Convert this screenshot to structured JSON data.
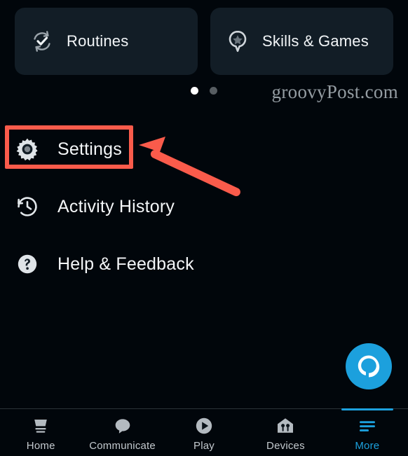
{
  "app": {
    "background_color": "#01060b",
    "card_color": "#121d26",
    "accent_color": "#1ca0dd",
    "annotation_color": "#fa5b4b"
  },
  "carousel": {
    "cards": [
      {
        "label": "Routines",
        "icon": "routines-refresh-check-icon"
      },
      {
        "label": "Skills & Games",
        "icon": "skills-pin-star-icon"
      }
    ],
    "dots": [
      {
        "active": true
      },
      {
        "active": false
      }
    ]
  },
  "watermark": {
    "text": "groovyPost.com"
  },
  "menu": {
    "items": [
      {
        "label": "Settings",
        "icon": "gear-icon",
        "highlighted": true
      },
      {
        "label": "Activity History",
        "icon": "clock-history-icon",
        "highlighted": false
      },
      {
        "label": "Help & Feedback",
        "icon": "question-circle-icon",
        "highlighted": false
      }
    ]
  },
  "annotation": {
    "highlight_target": "Settings",
    "arrow": "red-arrow-pointing-to-settings"
  },
  "alexa_button": {
    "label": "Alexa",
    "icon": "alexa-logo-icon"
  },
  "bottom_nav": {
    "items": [
      {
        "label": "Home",
        "icon": "echo-device-icon",
        "active": false
      },
      {
        "label": "Communicate",
        "icon": "speech-bubble-icon",
        "active": false
      },
      {
        "label": "Play",
        "icon": "play-circle-icon",
        "active": false
      },
      {
        "label": "Devices",
        "icon": "home-devices-icon",
        "active": false
      },
      {
        "label": "More",
        "icon": "menu-lines-icon",
        "active": true
      }
    ]
  }
}
